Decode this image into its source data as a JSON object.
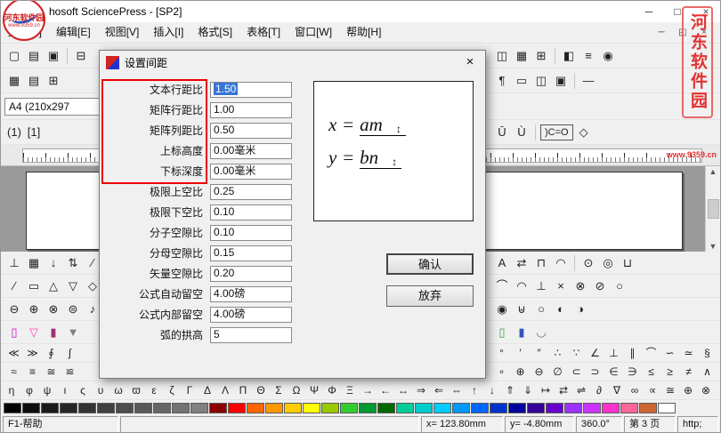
{
  "window": {
    "title": "hosoft SciencePress - [SP2]",
    "controls": {
      "minimize": "─",
      "maximize": "□",
      "close": "×"
    }
  },
  "watermark": {
    "site_name": "河东软件园",
    "site_url": "www.9359.cn"
  },
  "menu": {
    "items": [
      "文件[F]",
      "编辑[E]",
      "视图[V]",
      "插入[I]",
      "格式[S]",
      "表格[T]",
      "窗口[W]",
      "帮助[H]"
    ],
    "mdi": {
      "minimize": "─",
      "restore": "◱",
      "close": "×"
    }
  },
  "page_size_field": {
    "value": "A4  (210x297"
  },
  "scrollbar": {
    "up": "▲",
    "down": "▼"
  },
  "toolbars": {
    "row1_left": [
      {
        "name": "new-document-icon",
        "glyph": "▢"
      },
      {
        "name": "open-folder-icon",
        "glyph": "▤"
      },
      {
        "name": "save-icon",
        "glyph": "▣"
      },
      {
        "name": "separator",
        "glyph": ""
      },
      {
        "name": "print-icon",
        "glyph": "⊟"
      }
    ],
    "row1_right": [
      {
        "name": "print-preview-icon",
        "glyph": "◫"
      },
      {
        "name": "table-icon",
        "glyph": "▦"
      },
      {
        "name": "insert-grid-icon",
        "glyph": "⊞"
      },
      {
        "name": "separator",
        "glyph": ""
      },
      {
        "name": "window-split-icon",
        "glyph": "◧"
      },
      {
        "name": "list-view-icon",
        "glyph": "≡"
      },
      {
        "name": "zoom-icon",
        "glyph": "◉"
      }
    ],
    "row2_left": [
      {
        "name": "border-all-icon",
        "glyph": "▦"
      },
      {
        "name": "border-outside-icon",
        "glyph": "▤"
      },
      {
        "name": "insert-table-icon",
        "glyph": "⊞"
      }
    ],
    "row2_right": [
      {
        "name": "paragraph-marks-icon",
        "glyph": "¶"
      },
      {
        "name": "text-frame-icon",
        "glyph": "▭"
      },
      {
        "name": "columns-icon",
        "glyph": "◫"
      },
      {
        "name": "object-frame-icon",
        "glyph": "▣"
      },
      {
        "name": "separator",
        "glyph": ""
      },
      {
        "name": "line-style-icon",
        "glyph": "—"
      }
    ],
    "row3_right": [],
    "row4_left": [
      {
        "name": "numbering-paren-icon",
        "glyph": "(1)"
      },
      {
        "name": "numbering-bracket-icon",
        "glyph": "[1]"
      }
    ],
    "row4_right": [
      {
        "name": "u-macron-icon",
        "glyph": "Ū"
      },
      {
        "name": "u-grave-icon",
        "glyph": "Ù"
      },
      {
        "name": "separator",
        "glyph": ""
      },
      {
        "name": "carbonyl-group-icon",
        "glyph": ")C=O"
      },
      {
        "name": "diamond-shape-icon",
        "glyph": "◇"
      }
    ],
    "row5_left": [
      {
        "name": "tab-stop-icon",
        "glyph": "⊥"
      },
      {
        "name": "table-grid-icon",
        "glyph": "▦"
      },
      {
        "name": "arrow-down-icon",
        "glyph": "↓"
      },
      {
        "name": "arrow-updown-icon",
        "glyph": "⇅"
      },
      {
        "name": "draw-line-icon",
        "glyph": "∕"
      }
    ],
    "row5_right": [
      {
        "name": "letter-spacing-icon",
        "glyph": "A"
      },
      {
        "name": "swap-arrows-icon",
        "glyph": "⇄"
      },
      {
        "name": "cap-shape-icon",
        "glyph": "⊓"
      },
      {
        "name": "arc-icon",
        "glyph": "◠"
      },
      {
        "name": "separator",
        "glyph": ""
      },
      {
        "name": "cylinder-icon",
        "glyph": "⊙"
      },
      {
        "name": "sphere-icon",
        "glyph": "◎"
      },
      {
        "name": "cup-shape-icon",
        "glyph": "⊔"
      }
    ],
    "row6_left": [
      {
        "name": "pen-icon",
        "glyph": "∕"
      },
      {
        "name": "rectangle-icon",
        "glyph": "▭"
      },
      {
        "name": "triangle-up-icon",
        "glyph": "△"
      },
      {
        "name": "triangle-down-icon",
        "glyph": "▽"
      },
      {
        "name": "diamond-icon",
        "glyph": "◇"
      }
    ],
    "row6_right": [
      {
        "name": "arc-tool-icon",
        "glyph": "⌒"
      },
      {
        "name": "chord-icon",
        "glyph": "◠"
      },
      {
        "name": "perpendicular-icon",
        "glyph": "⊥"
      },
      {
        "name": "cross-icon",
        "glyph": "×"
      },
      {
        "name": "circled-times-icon",
        "glyph": "⊗"
      },
      {
        "name": "circled-slash-icon",
        "glyph": "⊘"
      },
      {
        "name": "circle-icon",
        "glyph": "○"
      }
    ],
    "row7_left": [
      {
        "name": "circled-minus-icon",
        "glyph": "⊖"
      },
      {
        "name": "circled-plus-icon",
        "glyph": "⊕"
      },
      {
        "name": "circled-times-icon",
        "glyph": "⊗"
      },
      {
        "name": "circled-equal-icon",
        "glyph": "⊜"
      },
      {
        "name": "music-note-icon",
        "glyph": "♪"
      }
    ],
    "row7_right": [
      {
        "name": "filled-circle-icon",
        "glyph": "◉"
      },
      {
        "name": "flask-icon",
        "glyph": "⊎"
      },
      {
        "name": "ring-icon",
        "glyph": "○"
      },
      {
        "name": "half-circle-left-icon",
        "glyph": "◐"
      },
      {
        "name": "half-circle-right-icon",
        "glyph": "◑"
      }
    ],
    "row8_left": [
      {
        "name": "beaker-icon",
        "glyph": "▯",
        "color": "#cc00cc"
      },
      {
        "name": "flask-icon",
        "glyph": "▽",
        "color": "#ff44aa"
      },
      {
        "name": "test-tube-icon",
        "glyph": "▮",
        "color": "#a03070"
      },
      {
        "name": "funnel-icon",
        "glyph": "▼",
        "color": "#808080"
      }
    ],
    "row8_right": [
      {
        "name": "tube-icon",
        "glyph": "▯",
        "color": "#3aa03a"
      },
      {
        "name": "bottle-icon",
        "glyph": "▮",
        "color": "#3355bb"
      },
      {
        "name": "dish-icon",
        "glyph": "◡",
        "color": "#666666"
      }
    ]
  },
  "symbols": {
    "sym1_left": [
      "≪",
      "≫",
      "∮",
      "∫"
    ],
    "sym1_right": [
      "°",
      "′",
      "″",
      "∴",
      "∵",
      "∠",
      "⊥",
      "∥",
      "⌒",
      "∽",
      "≃",
      "§"
    ],
    "sym2_left": [
      "≈",
      "≡",
      "≅",
      "≌"
    ],
    "sym2_right": [
      "∘",
      "⊕",
      "⊖",
      "∅",
      "⊂",
      "⊃",
      "∈",
      "∋",
      "≤",
      "≥",
      "≠",
      "∧"
    ],
    "greek": [
      "η",
      "φ",
      "ψ",
      "ι",
      "ς",
      "υ",
      "ω",
      "ϖ",
      "ε",
      "ζ",
      "Γ",
      "Δ",
      "Λ",
      "Π",
      "Θ",
      "Σ",
      "Ω",
      "Ψ",
      "Φ",
      "Ξ",
      "→",
      "←",
      "↔",
      "⇒",
      "⇐",
      "⇔",
      "↑",
      "↓",
      "⇑",
      "⇓",
      "↦",
      "⇄",
      "⇌",
      "∂",
      "∇",
      "∞",
      "∝",
      "≅",
      "⊕",
      "⊗"
    ]
  },
  "palette": [
    "#000000",
    "#0d0d0d",
    "#1a1a1a",
    "#262626",
    "#333333",
    "#404040",
    "#4d4d4d",
    "#595959",
    "#666666",
    "#737373",
    "#808080",
    "#8d0000",
    "#ff0000",
    "#ff6600",
    "#ff9900",
    "#ffcc00",
    "#ffff00",
    "#99cc00",
    "#33cc33",
    "#009933",
    "#006600",
    "#00cc99",
    "#00cccc",
    "#00ccff",
    "#0099ff",
    "#0066ff",
    "#0033cc",
    "#000099",
    "#330099",
    "#6600cc",
    "#9933ff",
    "#cc33ff",
    "#ff33cc",
    "#ff6699",
    "#cc6633",
    "#ffffff"
  ],
  "dialog": {
    "title": "设置间距",
    "close": "×",
    "fields": [
      {
        "label": "文本行距比",
        "value": "1.50",
        "selected": true
      },
      {
        "label": "矩阵行距比",
        "value": "1.00"
      },
      {
        "label": "矩阵列距比",
        "value": "0.50"
      },
      {
        "label": "上标高度",
        "value": "0.00毫米"
      },
      {
        "label": "下标深度",
        "value": "0.00毫米"
      },
      {
        "label": "极限上空比",
        "value": "0.25"
      },
      {
        "label": "极限下空比",
        "value": "0.10"
      },
      {
        "label": "分子空隙比",
        "value": "0.10"
      },
      {
        "label": "分母空隙比",
        "value": "0.15"
      },
      {
        "label": "矢量空隙比",
        "value": "0.20"
      },
      {
        "label": "公式自动留空",
        "value": "4.00磅"
      },
      {
        "label": "公式内部留空",
        "value": "4.00磅"
      },
      {
        "label": "弧的拱高",
        "value": "5"
      }
    ],
    "preview": {
      "lhs1": "x",
      "lhs2": "y",
      "equals": "=",
      "rhs1": "am",
      "rhs2": "bn",
      "arrow": "↕"
    },
    "buttons": {
      "confirm": "确认",
      "discard": "放弃"
    }
  },
  "statusbar": {
    "help": "F1-帮助",
    "x": "x= 123.80mm",
    "y": "y= -4.80mm",
    "angle": "360.0°",
    "page": "第 3 页",
    "extra": "http;"
  }
}
